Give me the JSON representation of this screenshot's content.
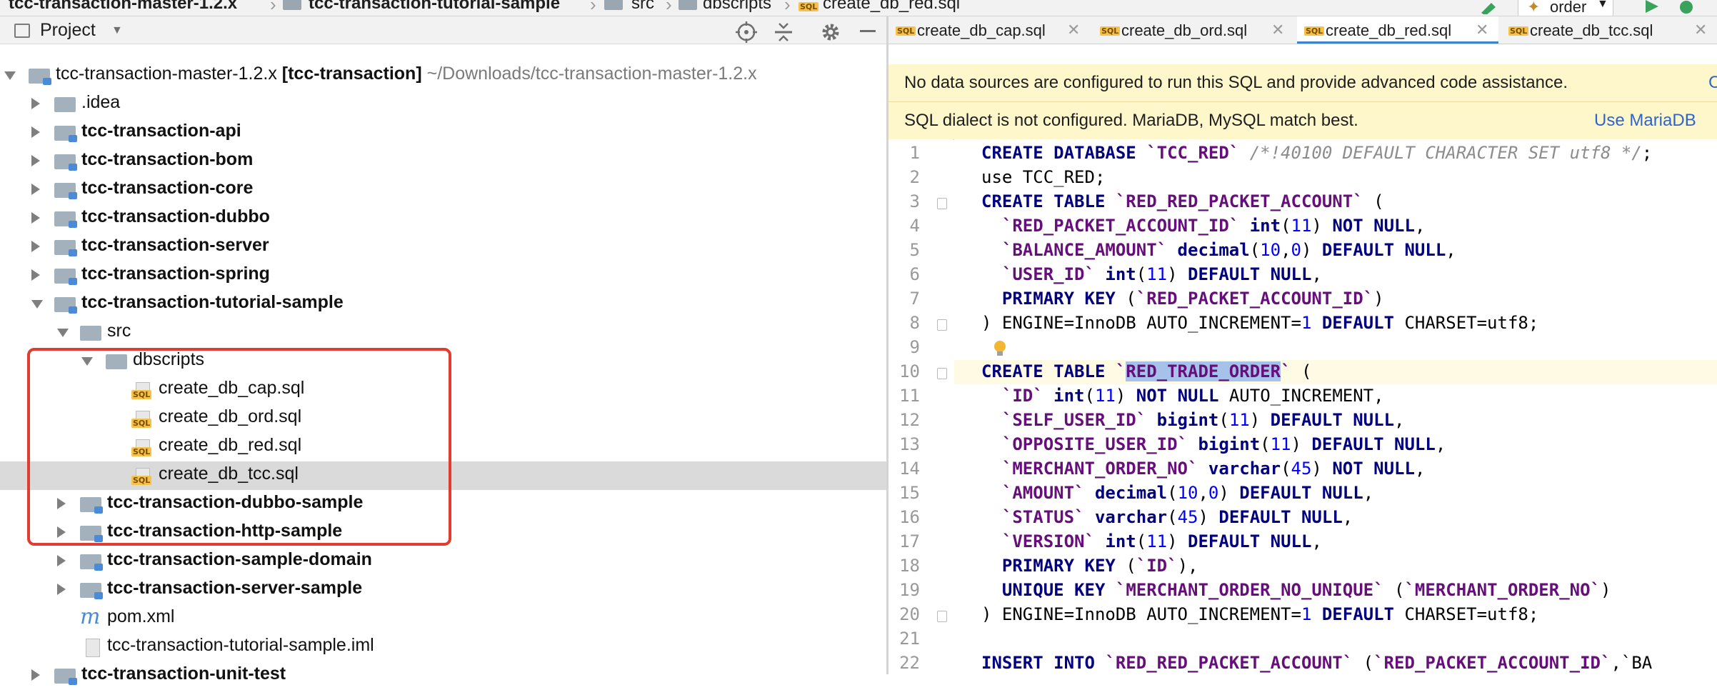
{
  "breadcrumb": {
    "items": [
      "tcc-transaction-master-1.2.x",
      "tcc-transaction-tutorial-sample",
      "src",
      "dbscripts",
      "create_db_red.sql"
    ]
  },
  "toolbar": {
    "run_config": "order",
    "sql_badge": "SQL"
  },
  "project_panel": {
    "title": "Project",
    "tree": [
      {
        "label": "tcc-transaction-master-1.2.x",
        "bold": false,
        "module": "[tcc-transaction]",
        "hint": "~/Downloads/tcc-transaction-master-1.2.x"
      },
      {
        "label": ".idea"
      },
      {
        "label": "tcc-transaction-api"
      },
      {
        "label": "tcc-transaction-bom"
      },
      {
        "label": "tcc-transaction-core"
      },
      {
        "label": "tcc-transaction-dubbo"
      },
      {
        "label": "tcc-transaction-server"
      },
      {
        "label": "tcc-transaction-spring"
      },
      {
        "label": "tcc-transaction-tutorial-sample"
      },
      {
        "label": "src"
      },
      {
        "label": "dbscripts"
      },
      {
        "label": "create_db_cap.sql"
      },
      {
        "label": "create_db_ord.sql"
      },
      {
        "label": "create_db_red.sql"
      },
      {
        "label": "create_db_tcc.sql"
      },
      {
        "label": "tcc-transaction-dubbo-sample"
      },
      {
        "label": "tcc-transaction-http-sample"
      },
      {
        "label": "tcc-transaction-sample-domain"
      },
      {
        "label": "tcc-transaction-server-sample"
      },
      {
        "label": "pom.xml"
      },
      {
        "label": "tcc-transaction-tutorial-sample.iml"
      },
      {
        "label": "tcc-transaction-unit-test"
      }
    ]
  },
  "editor": {
    "tabs": [
      {
        "label": "create_db_cap.sql",
        "active": false
      },
      {
        "label": "create_db_ord.sql",
        "active": false
      },
      {
        "label": "create_db_red.sql",
        "active": true
      },
      {
        "label": "create_db_tcc.sql",
        "active": false
      }
    ],
    "banner_datasource": {
      "text": "No data sources are configured to run this SQL and provide advanced code assistance.",
      "link": "C"
    },
    "banner_dialect": {
      "text": "SQL dialect is not configured. MariaDB, MySQL match best.",
      "link": "Use MariaDB"
    },
    "lines": [
      "CREATE DATABASE `TCC_RED` /*!40100 DEFAULT CHARACTER SET utf8 */;",
      "use TCC_RED;",
      "CREATE TABLE `RED_RED_PACKET_ACCOUNT` (",
      "  `RED_PACKET_ACCOUNT_ID` int(11) NOT NULL,",
      "  `BALANCE_AMOUNT` decimal(10,0) DEFAULT NULL,",
      "  `USER_ID` int(11) DEFAULT NULL,",
      "  PRIMARY KEY (`RED_PACKET_ACCOUNT_ID`)",
      ") ENGINE=InnoDB AUTO_INCREMENT=1 DEFAULT CHARSET=utf8;",
      "",
      "CREATE TABLE `RED_TRADE_ORDER` (",
      "  `ID` int(11) NOT NULL AUTO_INCREMENT,",
      "  `SELF_USER_ID` bigint(11) DEFAULT NULL,",
      "  `OPPOSITE_USER_ID` bigint(11) DEFAULT NULL,",
      "  `MERCHANT_ORDER_NO` varchar(45) NOT NULL,",
      "  `AMOUNT` decimal(10,0) DEFAULT NULL,",
      "  `STATUS` varchar(45) DEFAULT NULL,",
      "  `VERSION` int(11) DEFAULT NULL,",
      "  PRIMARY KEY (`ID`),",
      "  UNIQUE KEY `MERCHANT_ORDER_NO_UNIQUE` (`MERCHANT_ORDER_NO`)",
      ") ENGINE=InnoDB AUTO_INCREMENT=1 DEFAULT CHARSET=utf8;",
      "",
      "INSERT INTO `RED_RED_PACKET_ACCOUNT` (`RED_PACKET_ACCOUNT_ID`,`BA"
    ],
    "current_line": 10,
    "selected_text": "RED_TRADE_ORDER"
  },
  "colors": {
    "highlight_box": "#e23b30",
    "keyword": "#000080",
    "identifier": "#660e7a",
    "number": "#0000ff",
    "selection": "#a6c2ea"
  }
}
